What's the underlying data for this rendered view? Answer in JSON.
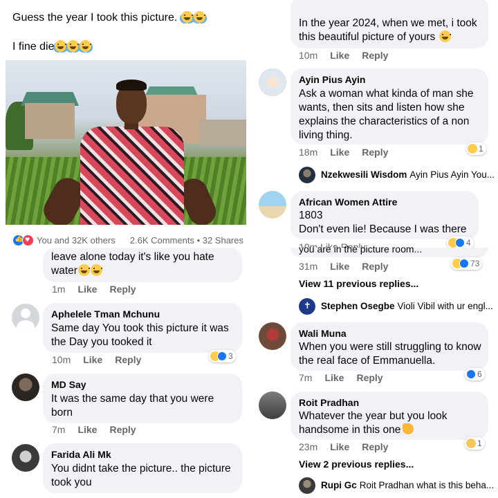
{
  "post": {
    "line1": "Guess the year I took this picture. ",
    "line2": "I fine die",
    "reactions_text": "You and 32K others",
    "counts_text": "2.6K Comments • 32 Shares"
  },
  "left_comments": [
    {
      "body": "leave alone today it's like you hate water",
      "time": "1m",
      "like": "Like",
      "reply": "Reply"
    },
    {
      "name": "Aphelele Tman Mchunu",
      "body": "Same day You took this picture it was the Day you tooked it",
      "time": "10m",
      "like": "Like",
      "reply": "Reply",
      "reaction_count": "3"
    },
    {
      "name": "MD Say",
      "body": "It was the same day that you were born",
      "time": "7m",
      "like": "Like",
      "reply": "Reply"
    },
    {
      "name": "Farida Ali Mk",
      "body": "You didnt take the picture.. the picture took you"
    }
  ],
  "right_comments": [
    {
      "body": "In the year 2024, when we met,  i took this beautiful picture of yours ",
      "time": "10m",
      "like": "Like",
      "reply": "Reply"
    },
    {
      "name": "Ayin Pius Ayin",
      "body": "Ask a woman what kinda of man she wants, then sits and listen how she explains the characteristics of a non living thing.",
      "time": "18m",
      "like": "Like",
      "reply": "Reply",
      "reaction_count": "1",
      "reply_preview": {
        "name": "Nzekwesili Wisdom",
        "snippet": "Ayin Pius Ayin You..."
      }
    },
    {
      "name": "African Women Attire",
      "body1": "1803",
      "body2": "Don't even lie! Because I was there",
      "reaction_count": "4",
      "clipped_meta": "10m   Like   Reply"
    },
    {
      "clipped_body": "you are in the picture room...",
      "time": "31m",
      "like": "Like",
      "reply": "Reply",
      "reaction_count": "73",
      "view_replies": "View 11 previous replies...",
      "reply_preview": {
        "name": "Stephen Osegbe",
        "snippet": "Violi Vibil with ur engl..."
      }
    },
    {
      "name": "Wali Muna",
      "body": "When you were still struggling to know the real face of Emmanuella.",
      "time": "7m",
      "like": "Like",
      "reply": "Reply",
      "reaction_count": "6"
    },
    {
      "name": "Roit Pradhan",
      "body": "Whatever the year but you look handsome in this one",
      "time": "23m",
      "like": "Like",
      "reply": "Reply",
      "reaction_count": "1",
      "view_replies": "View 2 previous replies...",
      "reply_preview": {
        "name": "Rupi Gc",
        "snippet": "Roit Pradhan what is this beha..."
      }
    }
  ],
  "colors": {
    "bubble": "#f0f2f5",
    "meta": "#65676b",
    "like_blue": "#1877f2",
    "love_red": "#f33e58"
  },
  "icons": [
    "laughing-emoji-icon",
    "like-reaction-icon",
    "love-reaction-icon",
    "pointing-hand-emoji-icon",
    "sad-emoji-icon",
    "default-avatar-icon"
  ]
}
